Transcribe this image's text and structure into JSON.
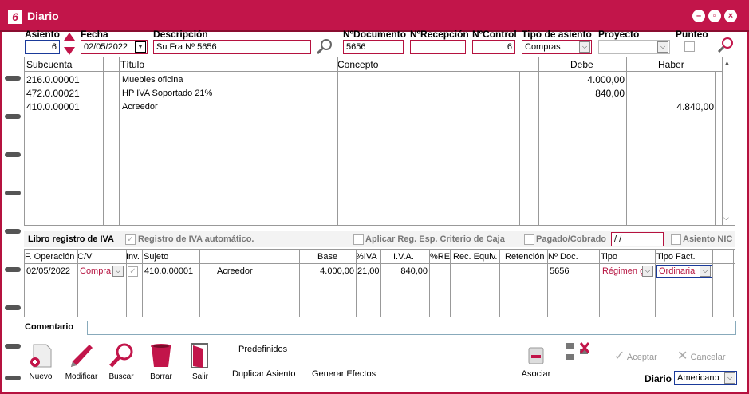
{
  "window": {
    "logo": "6",
    "title": "Diario"
  },
  "header": {
    "asiento_label": "Asiento",
    "asiento_value": "6",
    "fecha_label": "Fecha",
    "fecha_value": "02/05/2022",
    "descripcion_label": "Descripción",
    "descripcion_value": "Su Fra Nº 5656",
    "ndocumento_label": "NºDocumento",
    "ndocumento_value": "5656",
    "nrecepcion_label": "NºRecepción",
    "nrecepcion_value": "",
    "ncontrol_label": "NºControl",
    "ncontrol_value": "6",
    "tipo_asiento_label": "Tipo de asiento",
    "tipo_asiento_value": "Compras",
    "proyecto_label": "Proyecto",
    "proyecto_value": "",
    "punteo_label": "Punteo"
  },
  "lines": {
    "columns": [
      "Subcuenta",
      "Título",
      "Concepto",
      "Debe",
      "Haber"
    ],
    "rows": [
      {
        "subcuenta": "216.0.00001",
        "titulo": "Muebles oficina",
        "concepto": "",
        "debe": "4.000,00",
        "haber": ""
      },
      {
        "subcuenta": "472.0.00021",
        "titulo": "HP IVA Soportado 21%",
        "concepto": "",
        "debe": "840,00",
        "haber": ""
      },
      {
        "subcuenta": "410.0.00001",
        "titulo": "Acreedor",
        "concepto": "",
        "debe": "",
        "haber": "4.840,00"
      }
    ]
  },
  "iva": {
    "section_label": "Libro registro de IVA",
    "registro_auto": "Registro de IVA automático.",
    "aplicar_reg": "Aplicar Reg. Esp. Criterio de Caja",
    "pagado_label": "Pagado/Cobrado",
    "pagado_value": " / /",
    "asiento_nic": "Asiento NIC",
    "columns": [
      "F. Operación",
      "C/V",
      "Inv.",
      "Sujeto",
      "Base",
      "%IVA",
      "I.V.A.",
      "%RE",
      "Rec. Equiv.",
      "Retención",
      "Nº Doc.",
      "Tipo",
      "Tipo Fact."
    ],
    "row": {
      "fecha": "02/05/2022",
      "cv": "Compra",
      "sujeto": "410.0.00001",
      "nombre": "Acreedor",
      "base": "4.000,00",
      "piva": "21,00",
      "iva": "840,00",
      "pre": "",
      "rec": "",
      "ret": "",
      "ndoc": "5656",
      "tipo": "Régimen g",
      "tipofact": "Ordinaria"
    }
  },
  "comentario_label": "Comentario",
  "comentario_value": "",
  "toolbar": {
    "nuevo": "Nuevo",
    "modificar": "Modificar",
    "buscar": "Buscar",
    "borrar": "Borrar",
    "salir": "Salir",
    "predefinidos": "Predefinidos",
    "duplicar": "Duplicar Asiento",
    "generar": "Generar Efectos",
    "asociar": "Asociar",
    "aceptar": "Aceptar",
    "cancelar": "Cancelar",
    "diario_label": "Diario",
    "diario_value": "Americano"
  },
  "colors": {
    "accent": "#c2154a",
    "border": "#b5123f"
  }
}
